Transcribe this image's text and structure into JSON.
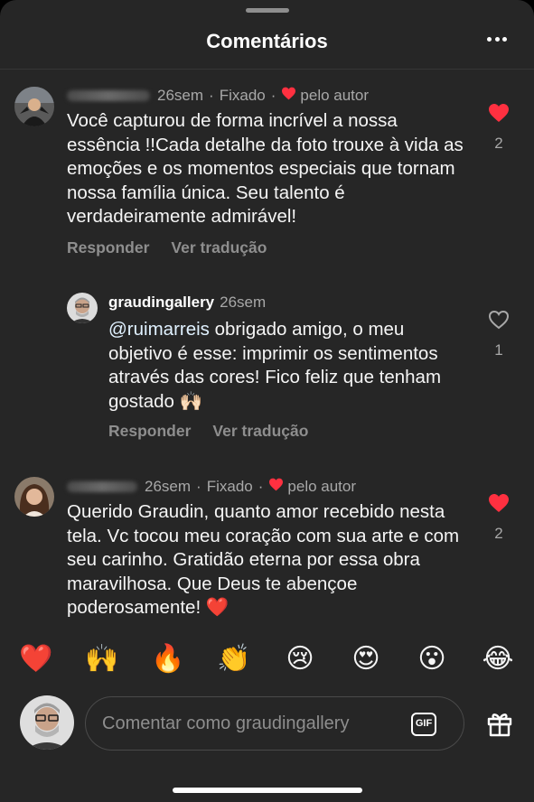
{
  "header": {
    "title": "Comentários",
    "more_icon": "ellipsis-icon"
  },
  "comments": [
    {
      "username_hidden": true,
      "time": "26sem",
      "pinned": "Fixado",
      "liked_by_author": "pelo autor",
      "text": "Você capturou de forma incrível a nossa essência !!Cada detalhe da foto trouxe à vida as emoções e os momentos especiais que tornam nossa família única. Seu talento é verdadeiramente admirável!",
      "reply_label": "Responder",
      "translate_label": "Ver tradução",
      "likes": "2",
      "liked": true,
      "reply": {
        "username": "graudingallery",
        "time": "26sem",
        "mention": "@ruimarreis",
        "text": " obrigado amigo, o meu objetivo é esse: imprimir os sentimentos através das cores! Fico feliz que tenham gostado 🙌🏻",
        "reply_label": "Responder",
        "translate_label": "Ver tradução",
        "likes": "1",
        "liked": false
      }
    },
    {
      "username_hidden": true,
      "time": "26sem",
      "pinned": "Fixado",
      "liked_by_author": "pelo autor",
      "text": "Querido Graudin, quanto amor recebido nesta tela. Vc tocou meu coração com sua arte e com seu carinho. Gratidão eterna por essa obra maravilhosa. Que Deus te abençoe poderosamente! ❤️",
      "likes": "2",
      "liked": true
    }
  ],
  "emoji_bar": [
    "❤️",
    "🙌",
    "🔥",
    "👏",
    "😢",
    "😍",
    "😮",
    "😂"
  ],
  "composer": {
    "placeholder": "Comentar como graudingallery",
    "gif_label": "GIF",
    "gift_icon": "gift-icon"
  },
  "colors": {
    "background": "#262626",
    "like_red": "#ff3040",
    "secondary_text": "#a8a8a8"
  }
}
